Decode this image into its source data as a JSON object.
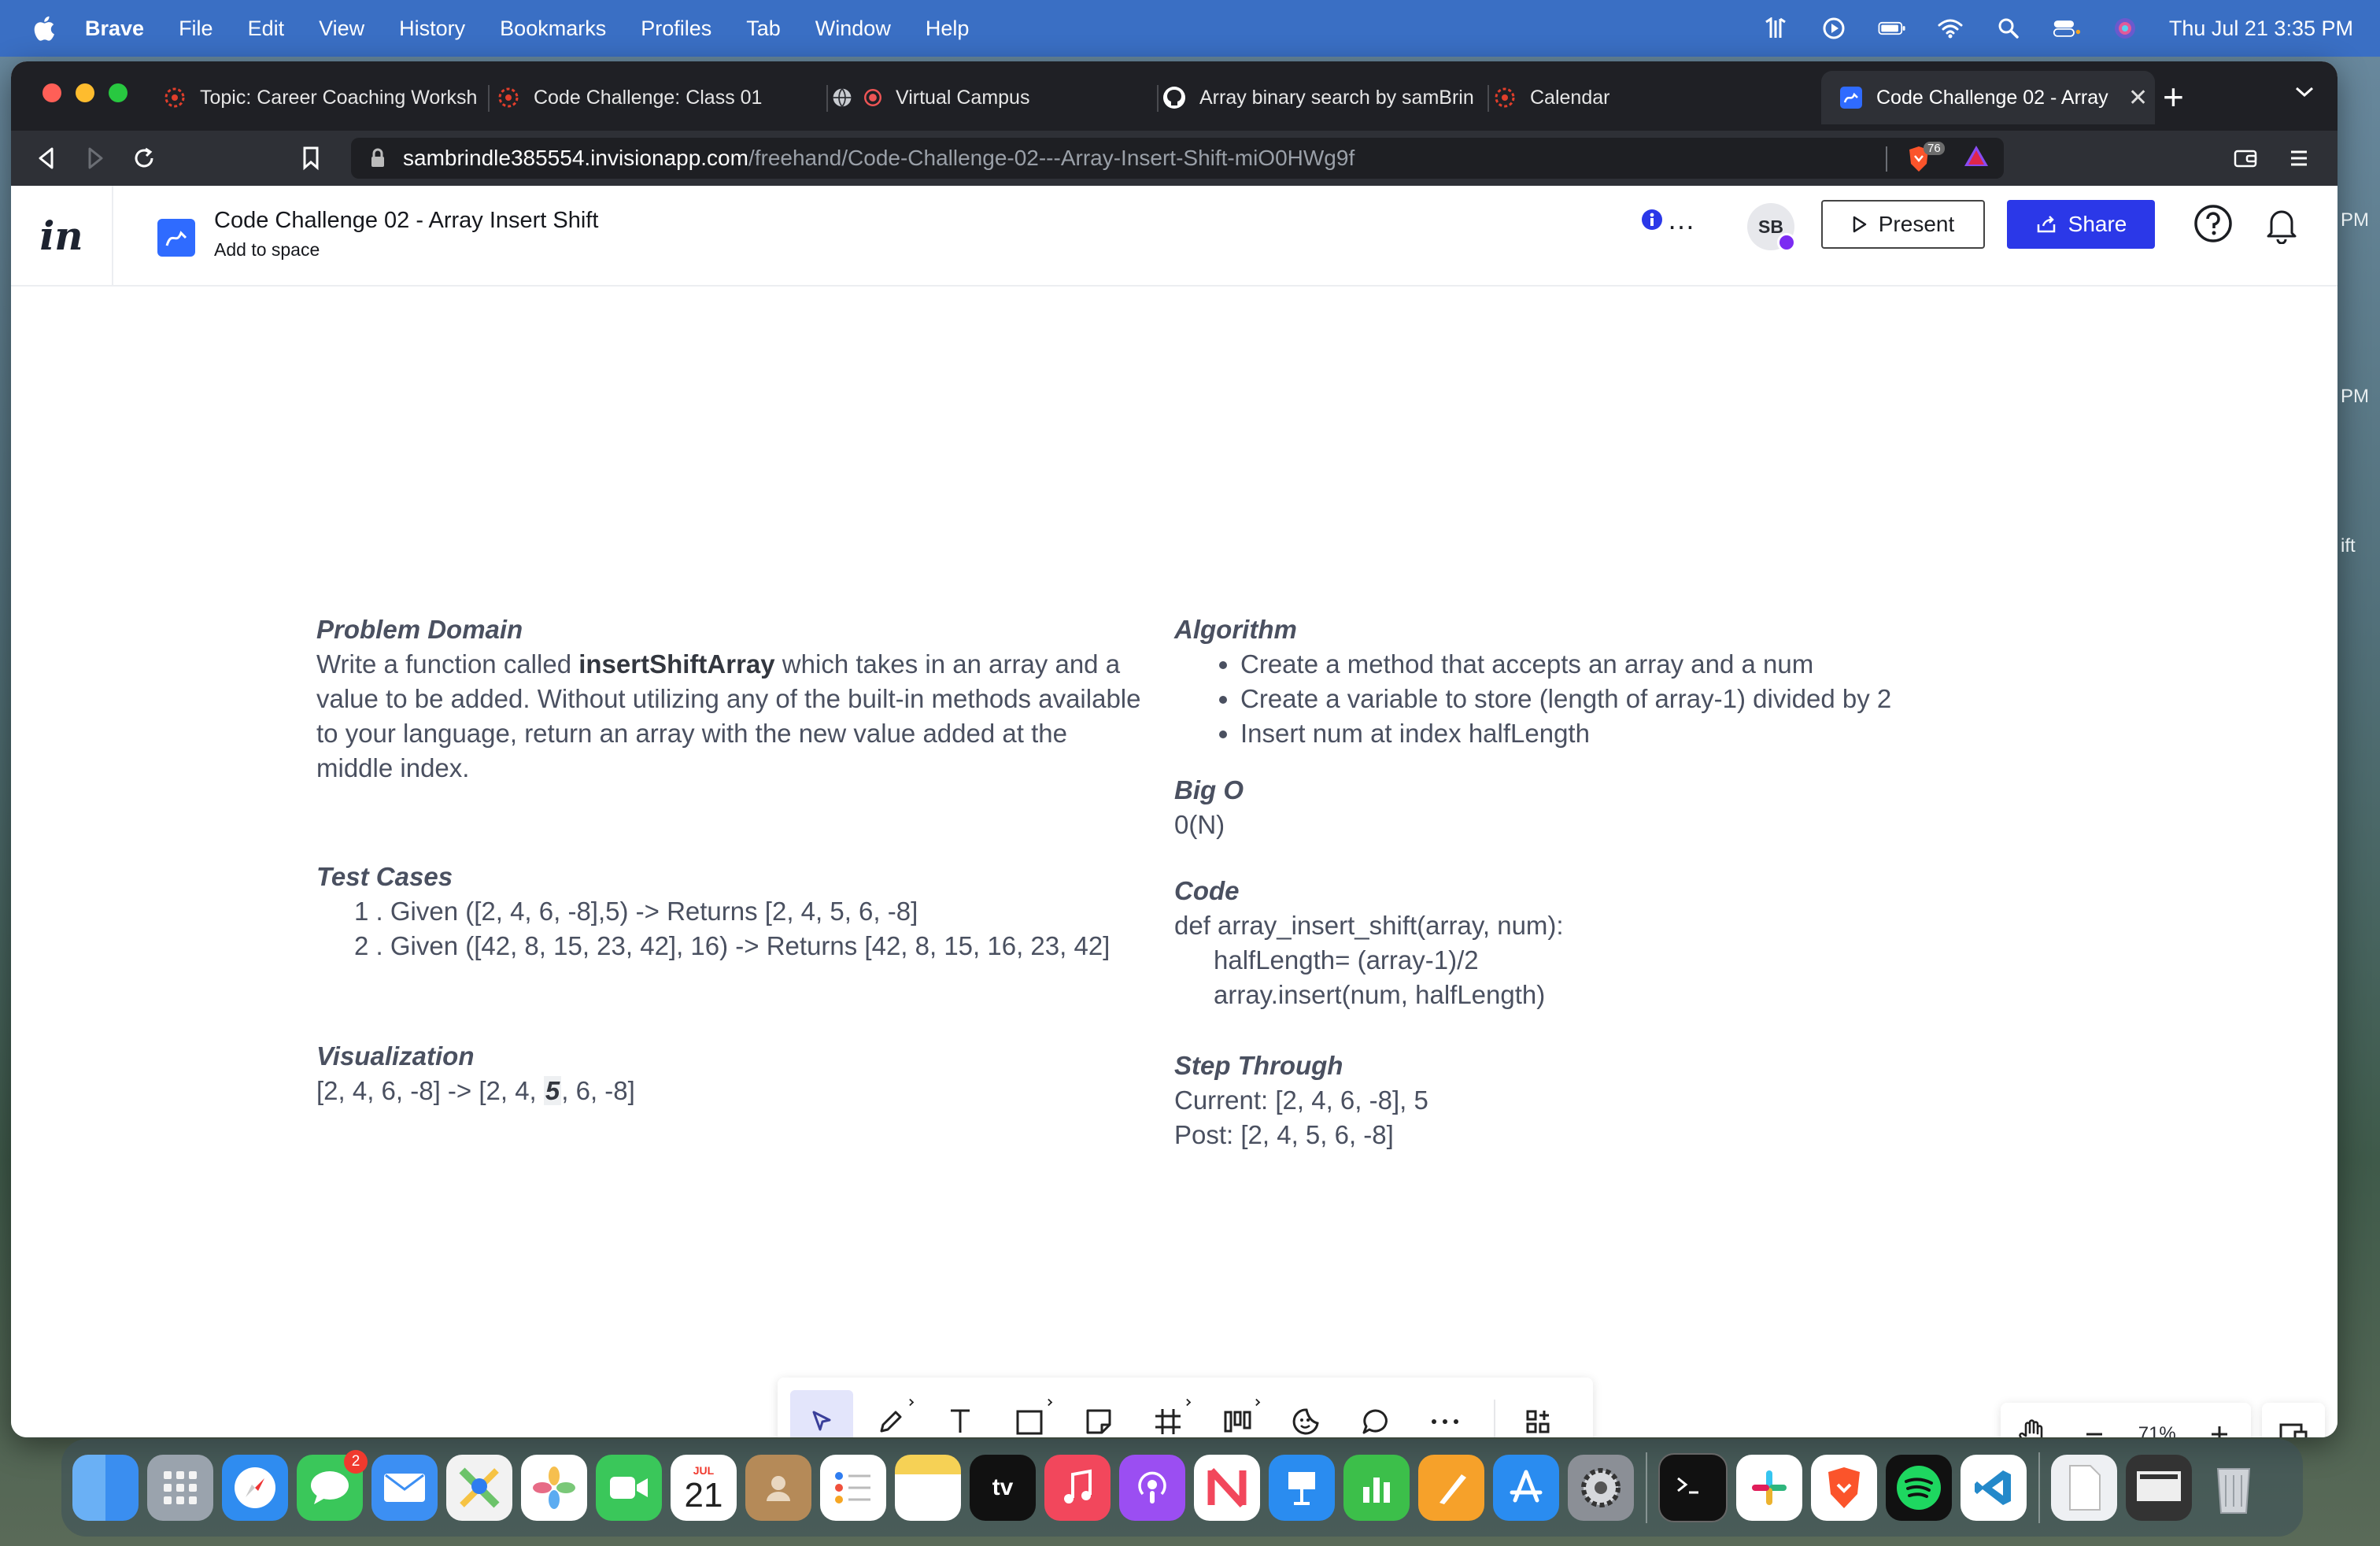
{
  "menubar": {
    "app": "Brave",
    "items": [
      "File",
      "Edit",
      "View",
      "History",
      "Bookmarks",
      "Profiles",
      "Tab",
      "Window",
      "Help"
    ],
    "clock": "Thu Jul 21  3:35 PM"
  },
  "tabs": [
    {
      "label": "Topic: Career Coaching Worksh",
      "icon": "canvas-logo-icon"
    },
    {
      "label": "Code Challenge: Class 01",
      "icon": "canvas-logo-icon"
    },
    {
      "label": "Virtual Campus",
      "icon": "globe-icon"
    },
    {
      "label": "Array binary search by samBrin",
      "icon": "github-icon"
    },
    {
      "label": "Calendar",
      "icon": "canvas-logo-icon"
    },
    {
      "label": "Code Challenge 02 - Array",
      "icon": "invision-freehand-icon",
      "active": true
    }
  ],
  "url": {
    "host": "sambrindle385554.invisionapp.com",
    "path": "/freehand/Code-Challenge-02---Array-Insert-Shift-miO0HWg9f",
    "shield_count": "76"
  },
  "header": {
    "logo": "in",
    "title": "Code Challenge 02 - Array Insert Shift",
    "subtitle": "Add to space",
    "more": "…",
    "avatar": "SB",
    "present": "Present",
    "share": "Share"
  },
  "problem_domain": {
    "heading": "Problem Domain",
    "text_1": "Write a function called ",
    "fn_name": "insertShiftArray",
    "text_2": " which takes in an array and a value to be added. Without utilizing any of the built-in methods available to your language, return an array with the new value added at the middle index."
  },
  "test_cases": {
    "heading": "Test Cases",
    "items": [
      "1 . Given ([2, 4, 6, -8],5) -> Returns [2, 4, 5, 6, -8]",
      "2 . Given ([42, 8, 15, 23, 42], 16) -> Returns [42, 8, 15, 16, 23, 42]"
    ]
  },
  "visualization": {
    "heading": "Visualization",
    "before": "[2, 4, 6, -8] -> [2, 4, ",
    "highlight": "5",
    "after": ", 6, -8]"
  },
  "algorithm": {
    "heading": "Algorithm",
    "items": [
      "Create a method that accepts an array and a num",
      "Create a variable to store (length of array-1) divided by 2",
      "Insert num at index halfLength"
    ]
  },
  "big_o": {
    "heading": "Big O",
    "value": "0(N)"
  },
  "code": {
    "heading": "Code",
    "lines": [
      "def array_insert_shift(array, num):",
      "halfLength= (array-1)/2",
      "array.insert(num, halfLength)"
    ]
  },
  "step_through": {
    "heading": "Step Through",
    "current": "Current: [2, 4, 6, -8], 5",
    "post": "Post: [2, 4, 5, 6, -8]"
  },
  "zoom": "71%",
  "peek": {
    "a": "PM",
    "b": "PM",
    "c": "ift"
  },
  "dock": {
    "messages_badge": "2",
    "calendar_month": "JUL",
    "calendar_day": "21",
    "tv_label": "tv"
  },
  "colors": {
    "menubar": "#3a6fc4",
    "share": "#2b38e8",
    "text": "#4a5060",
    "avatar_status": "#7b2bf2"
  }
}
